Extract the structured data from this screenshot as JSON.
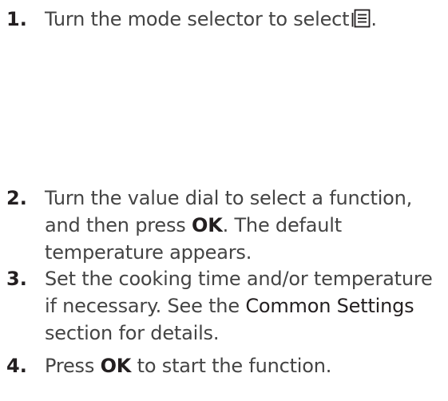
{
  "steps": [
    {
      "number": "1.",
      "text": "Turn the mode selector to select",
      "icon": "menu-list-icon",
      "end": "."
    },
    {
      "number": "2.",
      "before": "Turn the value dial to select a function, and then press",
      "bold": "OK",
      "after": ". The default temperature appears."
    },
    {
      "number": "3.",
      "before": "Set the cooking time and/or temperature if necessary. See the",
      "ref": "Common Settings",
      "after": "section for details."
    },
    {
      "number": "4.",
      "before": "Press",
      "bold": "OK",
      "after": "to start the function."
    }
  ],
  "colors": {
    "text": "#444444",
    "emphasis": "#231f20"
  }
}
